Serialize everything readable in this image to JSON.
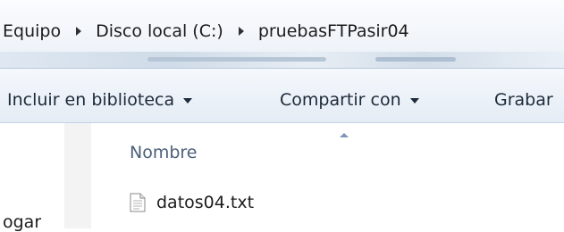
{
  "breadcrumb": [
    "Equipo",
    "Disco local (C:)",
    "pruebasFTPasir04"
  ],
  "toolbar": {
    "library_label": "Incluir en biblioteca",
    "share_label": "Compartir con",
    "burn_label": "Grabar"
  },
  "nav": {
    "partial_label": "ogar"
  },
  "filelist": {
    "column_name": "Nombre",
    "files": [
      {
        "name": "datos04.txt",
        "icon": "text-file-icon"
      }
    ]
  },
  "colors": {
    "header_text": "#4c607a",
    "toolbar_bg": "#e4ecf5",
    "toolbar_text": "#1c2a3a"
  }
}
